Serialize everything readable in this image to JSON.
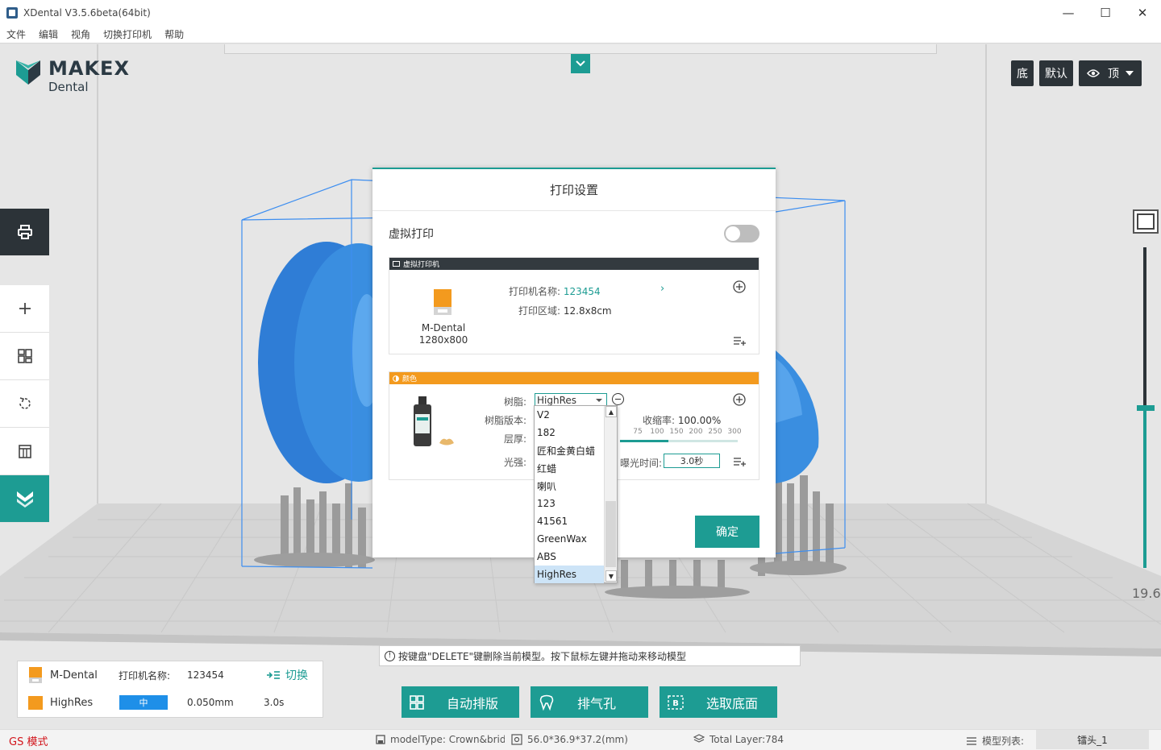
{
  "window": {
    "title": "XDental V3.5.6beta(64bit)",
    "minimize": "—",
    "maximize": "☐",
    "close": "✕"
  },
  "menu": [
    "文件",
    "编辑",
    "视角",
    "切换打印机",
    "帮助"
  ],
  "logo": {
    "main": "MAKEX",
    "sub": "Dental"
  },
  "view_buttons": {
    "bottom": "底",
    "default": "默认",
    "top": "顶"
  },
  "slider": {
    "value": "19.6"
  },
  "hint": "按键盘\"DELETE\"键删除当前模型。按下鼠标左键并拖动来移动模型",
  "summary": {
    "printer_model": "M-Dental",
    "printer_name_label": "打印机名称:",
    "printer_name": "123454",
    "switch_label": "切换",
    "resin": "HighRes",
    "layer_quality": "中",
    "layer_height": "0.050mm",
    "exposure": "3.0s"
  },
  "actions": {
    "auto_arrange": "自动排版",
    "vent_hole": "排气孔",
    "select_bottom": "选取底面"
  },
  "status": {
    "gs_mode": "GS 模式",
    "model_type": "modelType: Crown&bridge",
    "dimensions": "56.0*36.9*37.2(mm)",
    "total_layer": "Total Layer:784",
    "model_list_label": "模型列表:",
    "model_tab": "镭头_1"
  },
  "dialog": {
    "title": "打印设置",
    "virtual_print_label": "虚拟打印",
    "printer_card": {
      "header": "虚拟打印机",
      "model_line1": "M-Dental",
      "model_line2": "1280x800",
      "name_label": "打印机名称:",
      "name_value": "123454",
      "area_label": "打印区域:",
      "area_value": "12.8x8cm"
    },
    "resin_card": {
      "header": "颜色",
      "resin_label": "树脂:",
      "resin_value": "HighRes",
      "version_label": "树脂版本:",
      "thickness_label": "层厚:",
      "gloss_label": "光强:",
      "shrink_label": "收缩率:",
      "shrink_value": "100.00%",
      "scale_ticks": [
        "75",
        "100",
        "150",
        "200",
        "250",
        "300"
      ],
      "exposure_label": "曝光时间:",
      "exposure_value": "3.0秒"
    },
    "ok_label": "确定"
  },
  "resin_options": [
    "V2",
    "182",
    "匠和金黄白蜡",
    "红蜡",
    "喇叭",
    "123",
    "41561",
    "GreenWax",
    "ABS",
    "HighRes"
  ],
  "colors": {
    "accent": "#1d9c93",
    "dark": "#2c3338",
    "orange": "#f39a1e",
    "model_blue": "#3a8ee0",
    "bbox_blue": "#3d8ef0",
    "gs_red": "#d2141b"
  }
}
